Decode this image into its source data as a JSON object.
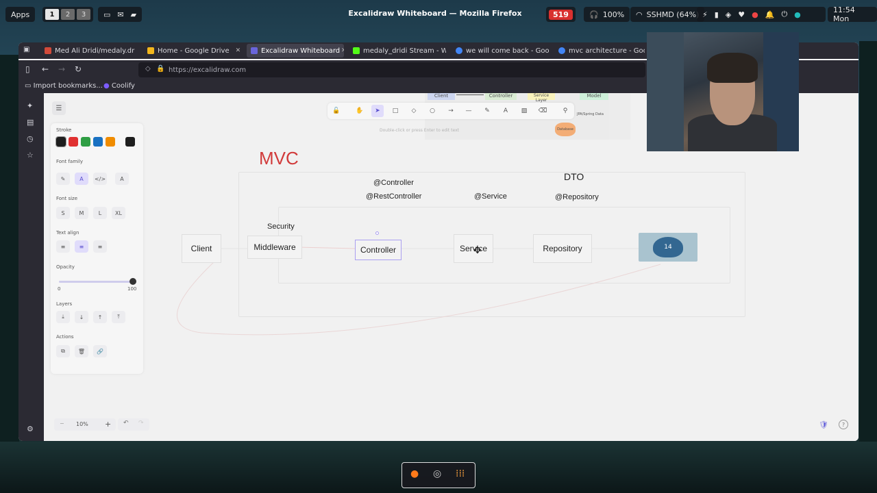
{
  "system_bar": {
    "apps_label": "Apps",
    "workspaces": [
      "1",
      "2",
      "3"
    ],
    "window_title": "Excalidraw Whiteboard — Mozilla Firefox",
    "notification_count": "519",
    "volume": "100%",
    "wifi": "SSHMD (64%)",
    "clock": "11:54 Mon"
  },
  "browser": {
    "tabs": [
      {
        "label": "Med Ali Dridi/medaly.dr",
        "color": "#d24a3a"
      },
      {
        "label": "Home - Google Drive",
        "color": "#f2b61c"
      },
      {
        "label": "Excalidraw Whiteboard",
        "color": "#6965db"
      },
      {
        "label": "medaly_dridi Stream - W",
        "color": "#53fc18"
      },
      {
        "label": "we will come back - Goo",
        "color": "#4285f4"
      },
      {
        "label": "mvc architecture - Goog",
        "color": "#4285f4"
      }
    ],
    "url": "https://excalidraw.com",
    "bookmarks": [
      "Import bookmarks...",
      "Coolify"
    ]
  },
  "properties": {
    "stroke_label": "Stroke",
    "stroke_colors": [
      "#1e1e1e",
      "#e03131",
      "#2f9e44",
      "#1971c2",
      "#f08c00"
    ],
    "font_family_label": "Font family",
    "font_size_label": "Font size",
    "font_sizes": [
      "S",
      "M",
      "L",
      "XL"
    ],
    "text_align_label": "Text align",
    "opacity_label": "Opacity",
    "opacity_min": "0",
    "opacity_max": "100",
    "layers_label": "Layers",
    "actions_label": "Actions"
  },
  "toolbar": {
    "hint": "Double-click or press Enter to edit text"
  },
  "diagram": {
    "title": "MVC",
    "security": "Security",
    "client": "Client",
    "middleware": "Middleware",
    "controller": "Controller",
    "service": "Service",
    "repository": "Repository",
    "postgres": "14",
    "annot_controller": "@Controller",
    "annot_restcontroller": "@RestController",
    "annot_service": "@Service",
    "annot_repository": "@Repository",
    "dto": "DTO"
  },
  "minimap": {
    "client": "Client",
    "controller": "Controller",
    "service_layer": "Service Layer",
    "model": "Model",
    "jpa": "JPA/Spring Data",
    "database": "Database"
  },
  "footer": {
    "zoom": "10%"
  }
}
